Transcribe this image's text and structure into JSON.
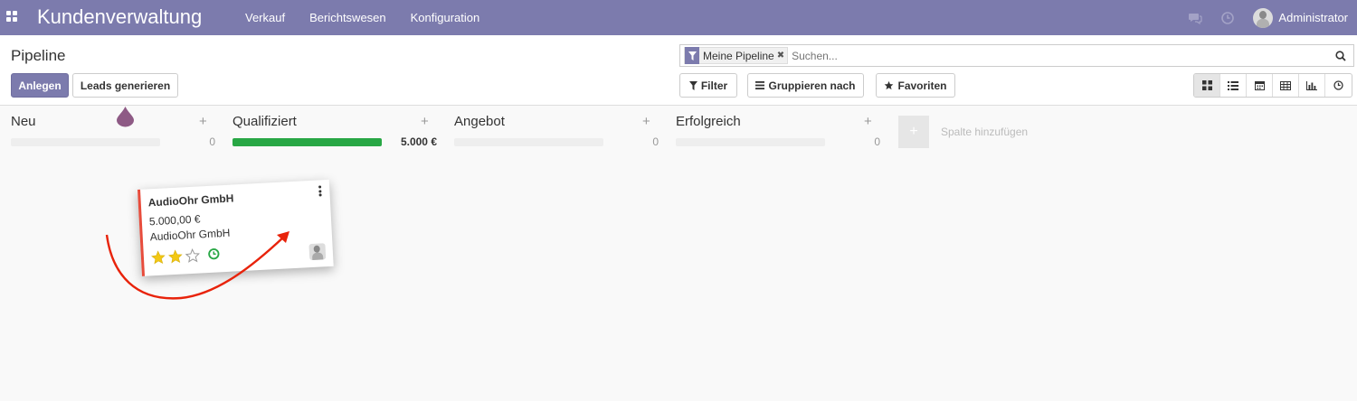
{
  "app": {
    "title": "Kundenverwaltung",
    "menu": [
      "Verkauf",
      "Berichtswesen",
      "Konfiguration"
    ],
    "user": "Administrator"
  },
  "control": {
    "breadcrumb": "Pipeline",
    "create_label": "Anlegen",
    "generate_label": "Leads generieren",
    "facet": "Meine Pipeline",
    "search_placeholder": "Suchen...",
    "filter_label": "Filter",
    "group_label": "Gruppieren nach",
    "favorites_label": "Favoriten",
    "views": [
      "kanban-icon",
      "list-icon",
      "calendar-icon",
      "pivot-icon",
      "graph-icon",
      "activity-icon"
    ]
  },
  "kanban": {
    "columns": [
      {
        "title": "Neu",
        "total": "0",
        "progress": 0
      },
      {
        "title": "Qualifiziert",
        "total": "5.000 €",
        "progress": 1.0
      },
      {
        "title": "Angebot",
        "total": "0",
        "progress": 0
      },
      {
        "title": "Erfolgreich",
        "total": "0",
        "progress": 0
      }
    ],
    "add_column_label": "Spalte hinzufügen",
    "card": {
      "title": "AudioOhr GmbH",
      "amount": "5.000,00 €",
      "customer": "AudioOhr GmbH",
      "stars": 2,
      "max_stars": 3
    }
  },
  "colors": {
    "brand": "#7c7bad",
    "progress": "#28a745",
    "card_border": "#e74c3c",
    "star": "#f3c814",
    "arrow": "#e8230b"
  }
}
